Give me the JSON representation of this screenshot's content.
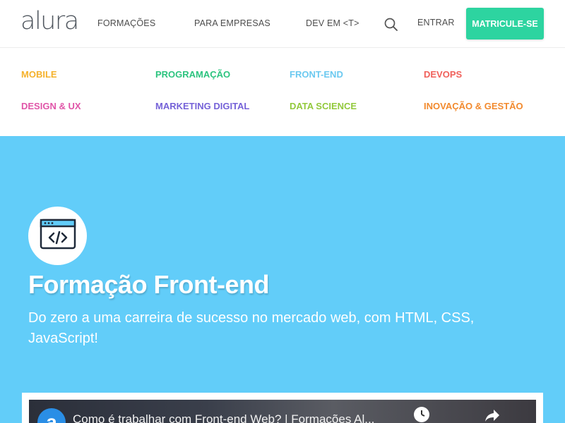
{
  "header": {
    "logo": "alura",
    "nav": [
      {
        "label": "FORMAÇÕES"
      },
      {
        "label": "PARA EMPRESAS"
      },
      {
        "label": "DEV EM <T>"
      }
    ],
    "entrar": "ENTRAR",
    "cta": "MATRICULE-SE"
  },
  "categories": [
    {
      "label": "MOBILE",
      "color": "#f5b12a"
    },
    {
      "label": "PROGRAMAÇÃO",
      "color": "#2cc47f"
    },
    {
      "label": "FRONT-END",
      "color": "#6bc9f0"
    },
    {
      "label": "DEVOPS",
      "color": "#f0605a"
    },
    {
      "label": "DESIGN & UX",
      "color": "#e055a8"
    },
    {
      "label": "MARKETING DIGITAL",
      "color": "#7562d8"
    },
    {
      "label": "DATA SCIENCE",
      "color": "#92c93c"
    },
    {
      "label": "INOVAÇÃO & GESTÃO",
      "color": "#f28a2e"
    }
  ],
  "hero": {
    "title": "Formação Front-end",
    "subtitle": "Do zero a uma carreira de sucesso no mercado web, com HTML, CSS, JavaScript!",
    "background": "#62cdf9",
    "icon": "code-window-icon"
  },
  "video": {
    "title": "Como é trabalhar com Front-end Web? | Formações Al...",
    "logo_letter": "a"
  },
  "colors": {
    "accent": "#2dd4a0"
  }
}
